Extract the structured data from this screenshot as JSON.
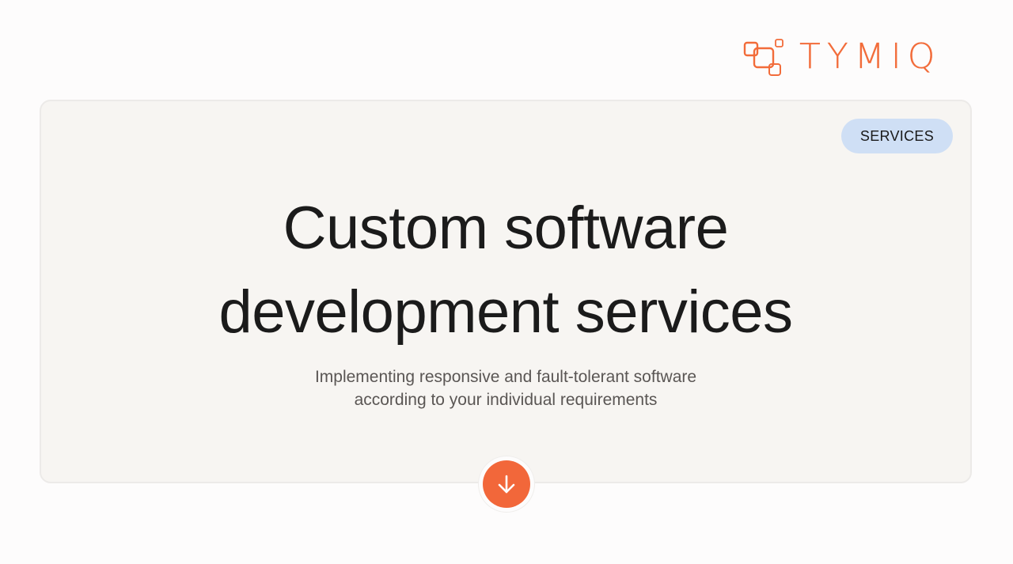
{
  "brand": {
    "name": "TYMIQ",
    "color": "#f26c3a"
  },
  "hero": {
    "badge": "SERVICES",
    "badge_color": "#cfdff5",
    "title_line1": "Custom software",
    "title_line2": "development services",
    "subtitle_line1": "Implementing responsive and fault-tolerant software",
    "subtitle_line2": "according to your individual requirements"
  },
  "scroll_button": {
    "icon": "arrow-down-icon",
    "color": "#f2673a"
  }
}
